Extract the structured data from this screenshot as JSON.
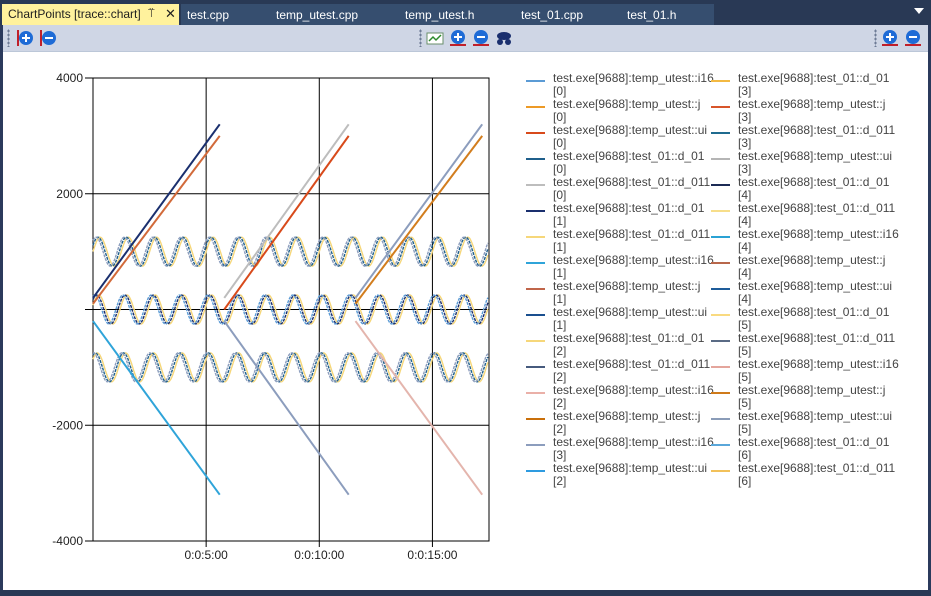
{
  "tabs": {
    "active_label": "ChartPoints [trace::chart]",
    "others": [
      "test.cpp",
      "temp_utest.cpp",
      "temp_utest.h",
      "test_01.cpp",
      "test_01.h"
    ]
  },
  "colors": {
    "tabbar": "#293955",
    "active_tab": "#fff29d",
    "toolbar": "#cfd6e5"
  },
  "toolbar_icons": [
    "zoom-in-icon",
    "zoom-out-icon",
    "fit-icon",
    "zoom-in-icon",
    "zoom-out-icon",
    "spy-icon",
    "zoom-in-icon",
    "zoom-out-icon"
  ],
  "chart_data": {
    "type": "line",
    "y_ticks": [
      "4000",
      "2000",
      "-2000",
      "-4000"
    ],
    "x_ticks": [
      "0:0:5:00",
      "0:0:10:00",
      "0:0:15:00"
    ],
    "ylim": [
      -4000,
      4000
    ],
    "xlim_minutes": [
      0,
      17.5
    ],
    "grid": true,
    "legend_placement": "right",
    "series": [
      {
        "name": "test.exe[9688]:temp_utest::i16",
        "idx": "[0]",
        "color": "#5b9bd5"
      },
      {
        "name": "test.exe[9688]:temp_utest::j",
        "idx": "[0]",
        "color": "#ed9a26"
      },
      {
        "name": "test.exe[9688]:temp_utest::ui",
        "idx": "[0]",
        "color": "#d84a1b"
      },
      {
        "name": "test.exe[9688]:test_01::d_01",
        "idx": "[0]",
        "color": "#1f5f8b"
      },
      {
        "name": "test.exe[9688]:test_01::d_011",
        "idx": "[0]",
        "color": "#bdbdbd"
      },
      {
        "name": "test.exe[9688]:test_01::d_01",
        "idx": "[1]",
        "color": "#1a2f6e"
      },
      {
        "name": "test.exe[9688]:test_01::d_011",
        "idx": "[1]",
        "color": "#f6d77a"
      },
      {
        "name": "test.exe[9688]:temp_utest::i16",
        "idx": "[1]",
        "color": "#2fa4d9"
      },
      {
        "name": "test.exe[9688]:temp_utest::j",
        "idx": "[1]",
        "color": "#c0654a"
      },
      {
        "name": "test.exe[9688]:temp_utest::ui",
        "idx": "[1]",
        "color": "#1a4f8f"
      },
      {
        "name": "test.exe[9688]:test_01::d_01",
        "idx": "[2]",
        "color": "#f6d77a"
      },
      {
        "name": "test.exe[9688]:test_01::d_011",
        "idx": "[2]",
        "color": "#465a7d"
      },
      {
        "name": "test.exe[9688]:temp_utest::i16",
        "idx": "[2]",
        "color": "#eab0a8"
      },
      {
        "name": "test.exe[9688]:temp_utest::j",
        "idx": "[2]",
        "color": "#c96f0a"
      },
      {
        "name": "test.exe[9688]:temp_utest::i16",
        "idx": "[3]",
        "color": "#8c9dbd"
      },
      {
        "name": "test.exe[9688]:temp_utest::ui",
        "idx": "[2]",
        "color": "#2e9be0"
      },
      {
        "name": "test.exe[9688]:test_01::d_01",
        "idx": "[3]",
        "color": "#f3b942"
      },
      {
        "name": "test.exe[9688]:temp_utest::j",
        "idx": "[3]",
        "color": "#d8552a"
      },
      {
        "name": "test.exe[9688]:test_01::d_011",
        "idx": "[3]",
        "color": "#1f6b8f"
      },
      {
        "name": "test.exe[9688]:temp_utest::ui",
        "idx": "[3]",
        "color": "#b5b5b5"
      },
      {
        "name": "test.exe[9688]:test_01::d_01",
        "idx": "[4]",
        "color": "#1c2b55"
      },
      {
        "name": "test.exe[9688]:test_01::d_011",
        "idx": "[4]",
        "color": "#f7de8a"
      },
      {
        "name": "test.exe[9688]:temp_utest::i16",
        "idx": "[4]",
        "color": "#2aa2d4"
      },
      {
        "name": "test.exe[9688]:temp_utest::j",
        "idx": "[4]",
        "color": "#b8674b"
      },
      {
        "name": "test.exe[9688]:temp_utest::ui",
        "idx": "[4]",
        "color": "#1e5c9a"
      },
      {
        "name": "test.exe[9688]:test_01::d_01",
        "idx": "[5]",
        "color": "#f9da80"
      },
      {
        "name": "test.exe[9688]:test_01::d_011",
        "idx": "[5]",
        "color": "#5a6b85"
      },
      {
        "name": "test.exe[9688]:temp_utest::i16",
        "idx": "[5]",
        "color": "#e4a59c"
      },
      {
        "name": "test.exe[9688]:temp_utest::j",
        "idx": "[5]",
        "color": "#cf7a1a"
      },
      {
        "name": "test.exe[9688]:temp_utest::ui",
        "idx": "[5]",
        "color": "#8a9cb8"
      },
      {
        "name": "test.exe[9688]:test_01::d_01",
        "idx": "[6]",
        "color": "#5aa7da"
      },
      {
        "name": "test.exe[9688]:test_01::d_011",
        "idx": "[6]",
        "color": "#f2c15a"
      }
    ],
    "ramps_up": [
      {
        "x0": 0,
        "y0": 200,
        "x1": 5.6,
        "y1": 3200,
        "color": "#1a2f6e"
      },
      {
        "x0": 0,
        "y0": 100,
        "x1": 5.6,
        "y1": 3000,
        "color": "#d26a3a"
      },
      {
        "x0": 5.8,
        "y0": 200,
        "x1": 11.3,
        "y1": 3200,
        "color": "#bdbdbd"
      },
      {
        "x0": 5.8,
        "y0": 0,
        "x1": 11.3,
        "y1": 3000,
        "color": "#d84a1b"
      },
      {
        "x0": 11.6,
        "y0": 200,
        "x1": 17.2,
        "y1": 3200,
        "color": "#8c9dbd"
      },
      {
        "x0": 11.6,
        "y0": 100,
        "x1": 17.2,
        "y1": 3000,
        "color": "#d27d1e"
      }
    ],
    "ramps_down": [
      {
        "x0": 0,
        "y0": -200,
        "x1": 5.6,
        "y1": -3200,
        "color": "#2fa4d9"
      },
      {
        "x0": 5.8,
        "y0": -200,
        "x1": 11.3,
        "y1": -3200,
        "color": "#8c9dbd"
      },
      {
        "x0": 11.6,
        "y0": -200,
        "x1": 17.2,
        "y1": -3200,
        "color": "#e4b5ad"
      }
    ],
    "sine_bands": [
      {
        "center": 1000,
        "amp": 250,
        "colors": [
          "#f6d77a",
          "#1f5f8b",
          "#8c9dbd"
        ]
      },
      {
        "center": 0,
        "amp": 250,
        "colors": [
          "#f6d77a",
          "#1a2f6e",
          "#5b9bd5"
        ]
      },
      {
        "center": -1000,
        "amp": 250,
        "colors": [
          "#f6d77a",
          "#1f5f8b",
          "#8c9dbd"
        ]
      }
    ]
  }
}
